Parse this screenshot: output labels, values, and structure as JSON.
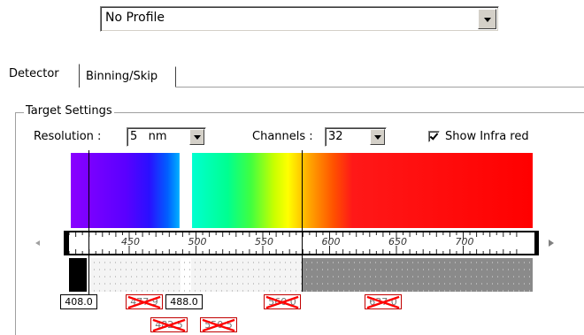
{
  "profile": {
    "value": "No Profile"
  },
  "tabs": [
    {
      "label": "Detector",
      "active": true
    },
    {
      "label": "Binning/Skip",
      "active": false
    }
  ],
  "group_title": "Target Settings",
  "resolution": {
    "label": "Resolution :",
    "value": "5   nm"
  },
  "channels": {
    "label": "Channels :",
    "value": "32"
  },
  "show_ir": {
    "label": "Show Infra red",
    "checked": true
  },
  "ruler_labels": [
    "450",
    "500",
    "550",
    "600",
    "650",
    "700"
  ],
  "markers": [
    {
      "label": "408.0",
      "crossed": false
    },
    {
      "label": "477.9",
      "crossed": true
    },
    {
      "label": "488.0",
      "crossed": false
    },
    {
      "label": "560.0",
      "crossed": true
    },
    {
      "label": "637.0",
      "crossed": true
    },
    {
      "label": "482.5",
      "crossed": true
    },
    {
      "label": "550.5",
      "crossed": true
    }
  ],
  "colors": {
    "face": "#d4d0c8",
    "marker_cross": "#ff0000"
  }
}
